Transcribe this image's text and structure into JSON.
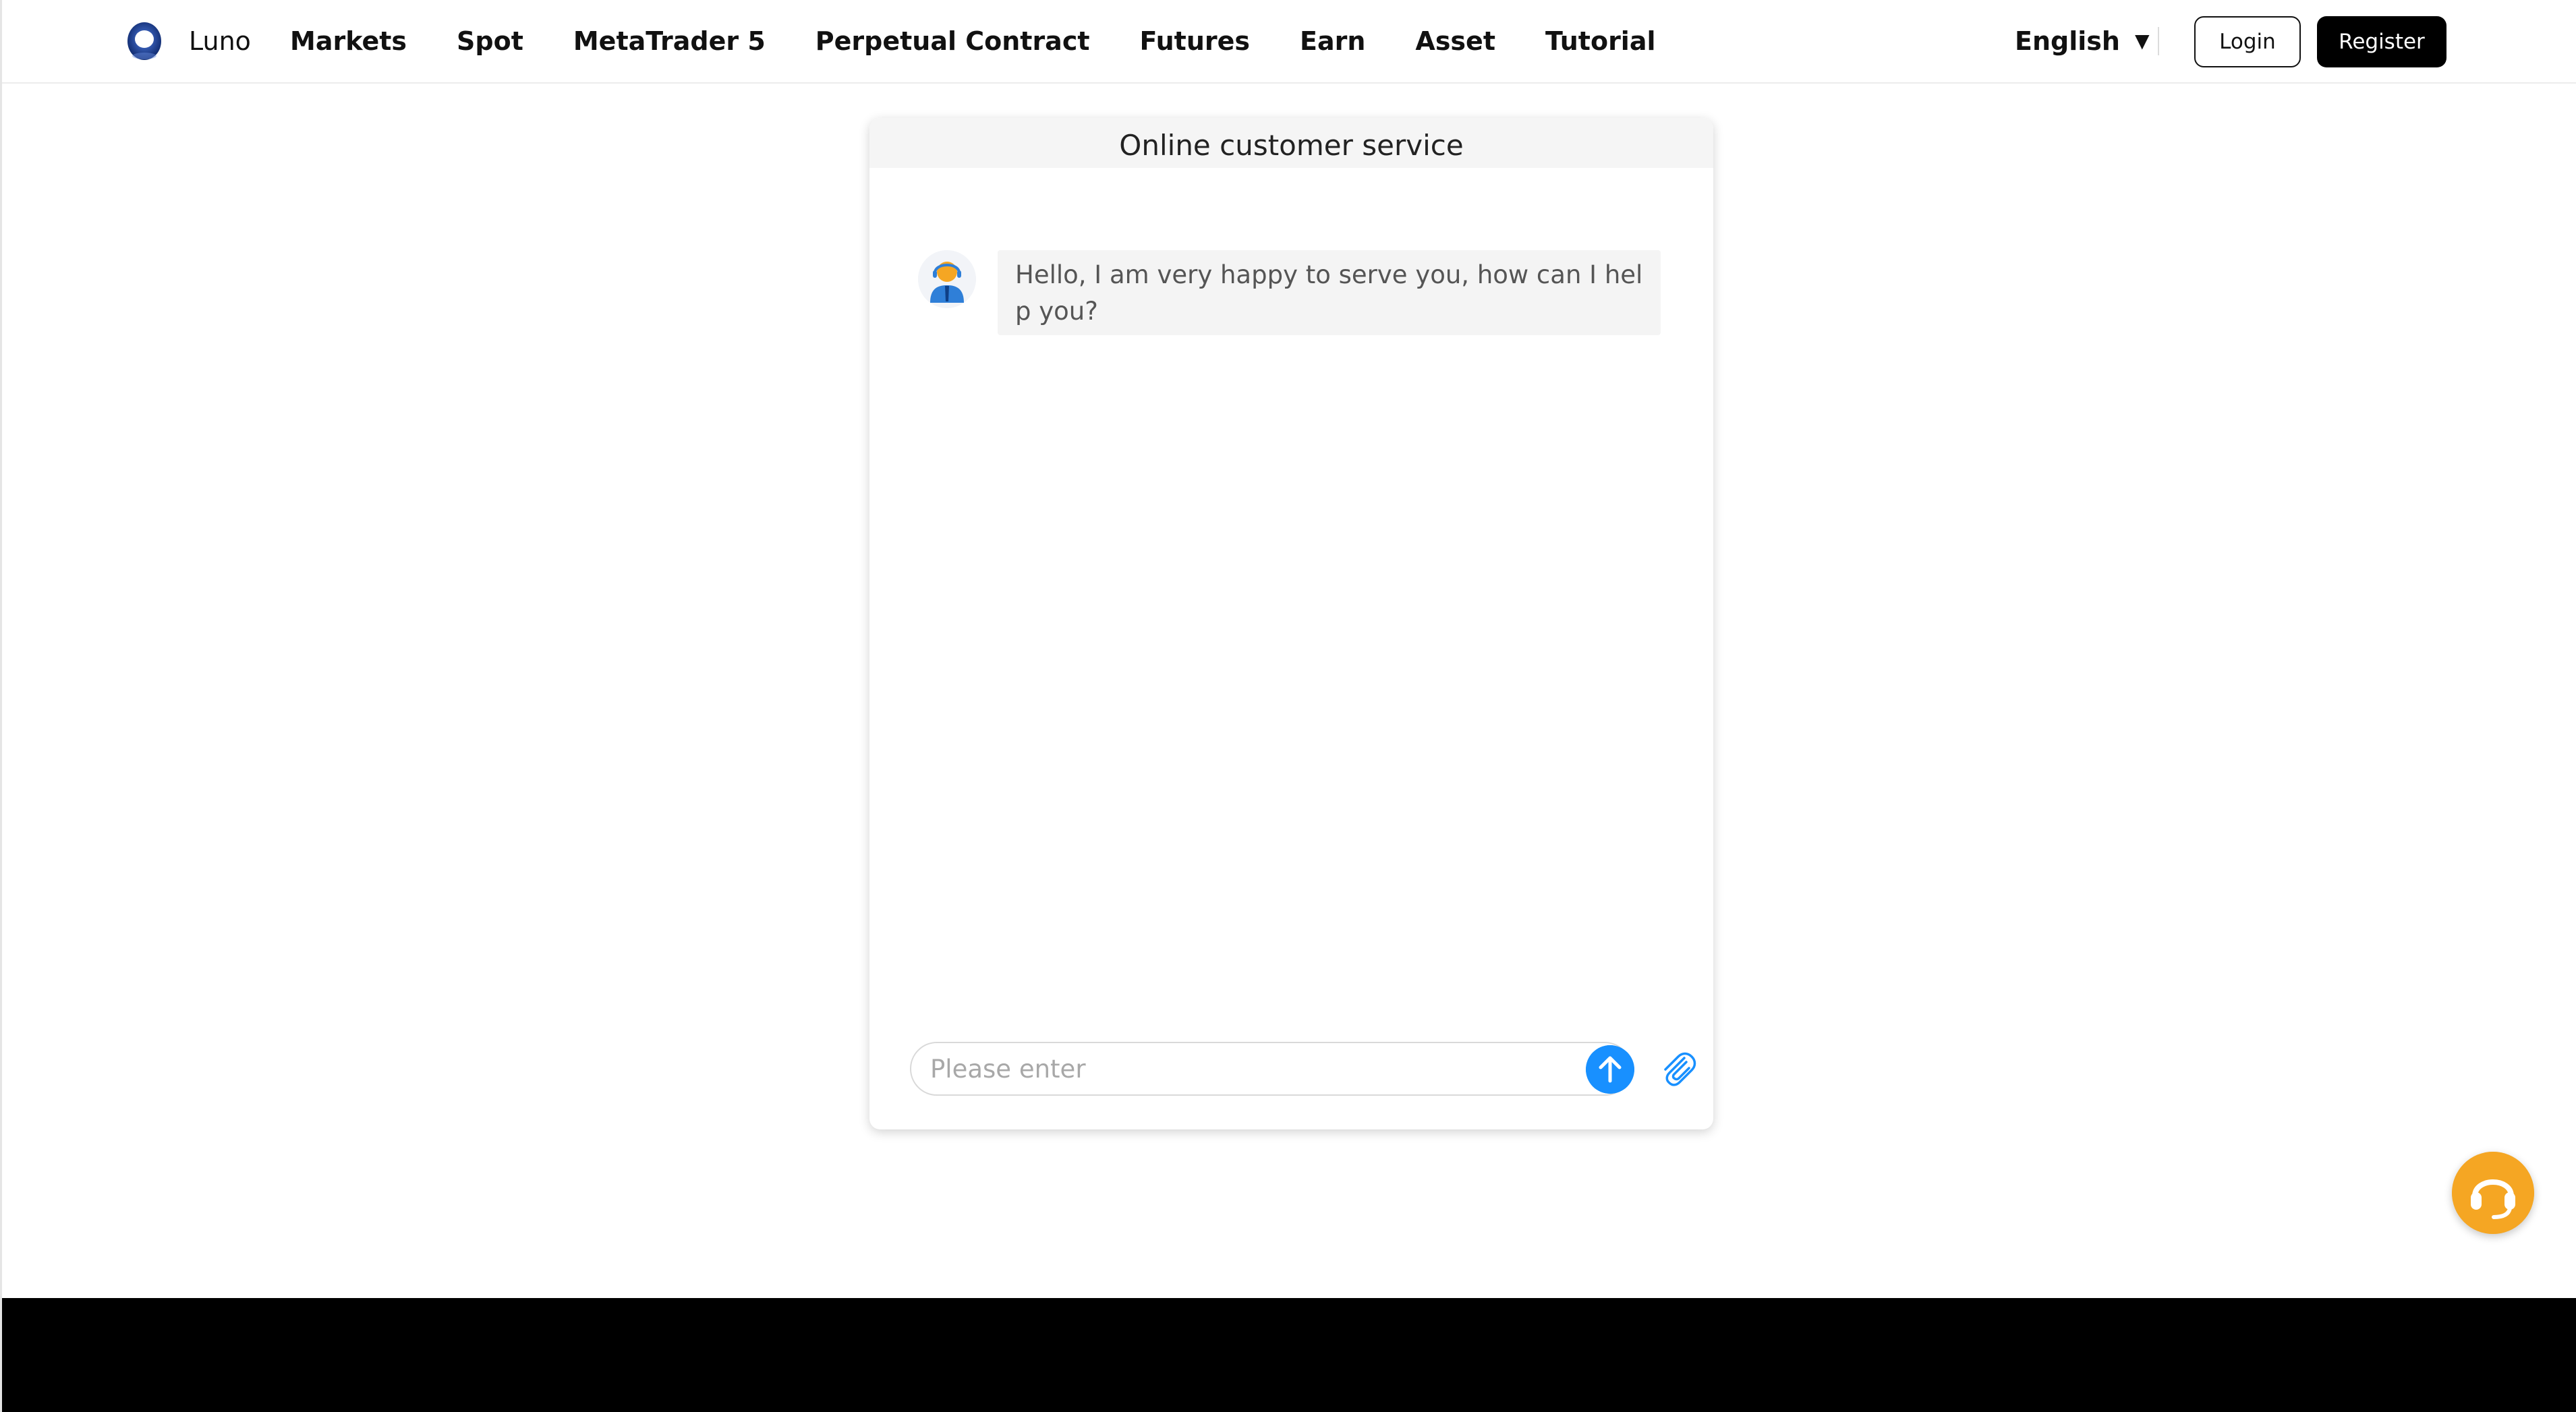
{
  "header": {
    "brand": "Luno",
    "nav": [
      "Markets",
      "Spot",
      "MetaTrader 5",
      "Perpetual Contract",
      "Futures",
      "Earn",
      "Asset",
      "Tutorial"
    ],
    "language": "English",
    "login_label": "Login",
    "register_label": "Register"
  },
  "chat": {
    "title": "Online customer service",
    "messages": [
      {
        "sender": "agent",
        "text": "Hello, I am very happy to serve you, how can I help you?"
      }
    ],
    "input": {
      "placeholder": "Please enter",
      "value": ""
    }
  },
  "icons": {
    "logo": "luno-logo-icon",
    "language_caret": "caret-down-icon",
    "agent_avatar": "support-agent-avatar-icon",
    "send": "arrow-up-icon",
    "attach": "paperclip-icon",
    "support": "headset-icon"
  },
  "colors": {
    "accent_blue": "#1890ff",
    "support_orange": "#f5a623",
    "brand_navy": "#1e3a8a",
    "black": "#000000"
  }
}
